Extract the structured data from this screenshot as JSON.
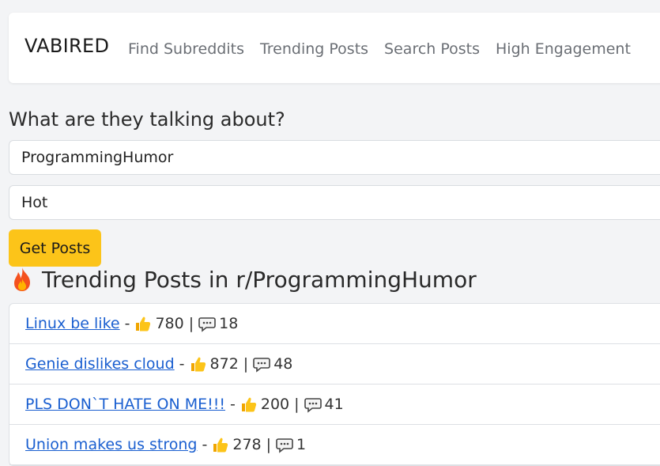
{
  "brand": "VABIRED",
  "nav": [
    "Find Subreddits",
    "Trending Posts",
    "Search Posts",
    "High Engagement"
  ],
  "question": "What are they talking about?",
  "subreddit_value": "ProgrammingHumor",
  "sort_value": "Hot",
  "button_label": "Get Posts",
  "heading": "Trending Posts in r/ProgrammingHumor",
  "separator": "-",
  "pipe": "|",
  "posts": [
    {
      "title": "Linux be like",
      "likes": "780",
      "comments": "18"
    },
    {
      "title": "Genie dislikes cloud",
      "likes": "872",
      "comments": "48"
    },
    {
      "title": "PLS DON`T HATE ON ME!!!",
      "likes": "200",
      "comments": "41"
    },
    {
      "title": "Union makes us strong",
      "likes": "278",
      "comments": "1"
    }
  ],
  "colors": {
    "accent": "#fcc419",
    "link": "#1a5fd0",
    "icons": "thumbs-up, speech-bubble, fire"
  }
}
